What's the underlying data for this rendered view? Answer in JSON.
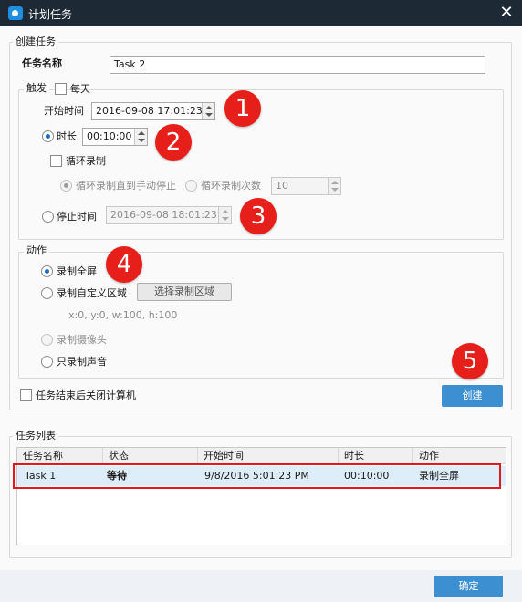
{
  "window": {
    "title": "计划任务"
  },
  "create": {
    "group_label": "创建任务",
    "task_name_label": "任务名称",
    "task_name_value": "Task 2",
    "trigger": {
      "group_label": "触发",
      "daily_label": "每天",
      "start_time_label": "开始时间",
      "start_time_value": "2016-09-08 17:01:23",
      "duration_label": "时长",
      "duration_value": "00:10:00",
      "loop_label": "循环录制",
      "loop_until_stop_label": "循环录制直到手动停止",
      "loop_count_label": "循环录制次数",
      "loop_count_value": "10",
      "stop_time_label": "停止时间",
      "stop_time_value": "2016-09-08 18:01:23"
    },
    "action": {
      "group_label": "动作",
      "fullscreen_label": "录制全屏",
      "custom_area_label": "录制自定义区域",
      "select_area_button": "选择录制区域",
      "area_info": "x:0, y:0, w:100, h:100",
      "camera_label": "录制摄像头",
      "audio_only_label": "只录制声音"
    },
    "shutdown_label": "任务结束后关闭计算机",
    "create_button": "创建"
  },
  "task_list": {
    "group_label": "任务列表",
    "columns": [
      "任务名称",
      "状态",
      "开始时间",
      "时长",
      "动作"
    ],
    "rows": [
      {
        "name": "Task 1",
        "status": "等待",
        "start": "9/8/2016 5:01:23 PM",
        "duration": "00:10:00",
        "action": "录制全屏"
      }
    ]
  },
  "ok_button": "确定",
  "annotations": [
    "1",
    "2",
    "3",
    "4",
    "5"
  ],
  "colors": {
    "titlebar": "#1d2a35",
    "primary_button": "#3c8fd0",
    "annotation": "#e71f1a"
  }
}
